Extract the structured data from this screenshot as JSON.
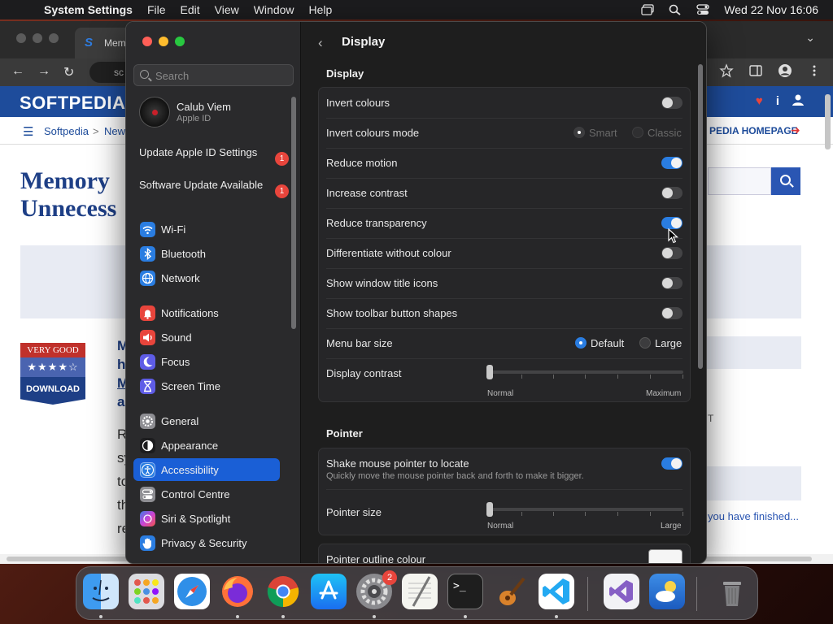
{
  "menubar": {
    "app": "System Settings",
    "items": [
      "File",
      "Edit",
      "View",
      "Window",
      "Help"
    ],
    "clock": "Wed 22 Nov  16:06"
  },
  "browser": {
    "tab_label": "Mem",
    "url_text": "sc",
    "logo": "SOFTPEDIA",
    "breadcrumb": [
      "Softpedia",
      "New"
    ],
    "breadcrumb_sep": ">",
    "homepage_link": "PEDIA HOMEPAGE",
    "headline_lines": [
      "Memory",
      "Unnecess"
    ],
    "rating": {
      "label": "VERY GOOD",
      "stars": "★★★★☆",
      "download": "DOWNLOAD"
    },
    "blurb_lines": [
      "M",
      "h",
      "M",
      "a"
    ],
    "body_lines": [
      "R",
      "sy",
      "to",
      "th",
      "re"
    ],
    "right_text_t": "T",
    "right_text": "you have finished..."
  },
  "sidebar": {
    "search_placeholder": "Search",
    "user": {
      "name": "Calub Viem",
      "subtitle": "Apple ID"
    },
    "notices": [
      {
        "label": "Update Apple ID Settings",
        "badge": "1"
      },
      {
        "label": "Software Update Available",
        "badge": "1"
      }
    ],
    "items": [
      {
        "label": "Wi-Fi",
        "icon": "wifi-icon",
        "color": "#2a7de1"
      },
      {
        "label": "Bluetooth",
        "icon": "bluetooth-icon",
        "color": "#2a7de1"
      },
      {
        "label": "Network",
        "icon": "network-icon",
        "color": "#2a7de1"
      },
      {
        "label": "Notifications",
        "icon": "notifications-icon",
        "color": "#e8453c"
      },
      {
        "label": "Sound",
        "icon": "sound-icon",
        "color": "#e8453c"
      },
      {
        "label": "Focus",
        "icon": "focus-icon",
        "color": "#5e5ce6"
      },
      {
        "label": "Screen Time",
        "icon": "screen-time-icon",
        "color": "#5e5ce6"
      },
      {
        "label": "General",
        "icon": "general-icon",
        "color": "#8e8e93"
      },
      {
        "label": "Appearance",
        "icon": "appearance-icon",
        "color": "#1c1c1e"
      },
      {
        "label": "Accessibility",
        "icon": "accessibility-icon",
        "color": "#2a7de1"
      },
      {
        "label": "Control Centre",
        "icon": "control-centre-icon",
        "color": "#8e8e93"
      },
      {
        "label": "Siri & Spotlight",
        "icon": "siri-icon",
        "color": "#b34fd6"
      },
      {
        "label": "Privacy & Security",
        "icon": "privacy-hand-icon",
        "color": "#2a7de1"
      }
    ],
    "active_item": "Accessibility"
  },
  "content": {
    "title": "Display",
    "display_section": "Display",
    "display_rows": {
      "invert_colours": {
        "label": "Invert colours",
        "on": false
      },
      "invert_mode": {
        "label": "Invert colours mode",
        "options": [
          "Smart",
          "Classic"
        ]
      },
      "reduce_motion": {
        "label": "Reduce motion",
        "on": true
      },
      "increase_contrast": {
        "label": "Increase contrast",
        "on": false
      },
      "reduce_transparency": {
        "label": "Reduce transparency",
        "on": true
      },
      "differentiate": {
        "label": "Differentiate without colour",
        "on": false
      },
      "window_title_icons": {
        "label": "Show window title icons",
        "on": false
      },
      "toolbar_shapes": {
        "label": "Show toolbar button shapes",
        "on": false
      },
      "menu_bar_size": {
        "label": "Menu bar size",
        "options": [
          "Default",
          "Large"
        ],
        "selected": "Default"
      },
      "display_contrast": {
        "label": "Display contrast",
        "min_label": "Normal",
        "max_label": "Maximum",
        "value": 0
      }
    },
    "pointer_section": "Pointer",
    "pointer_rows": {
      "shake": {
        "label": "Shake mouse pointer to locate",
        "sublabel": "Quickly move the mouse pointer back and forth to make it bigger.",
        "on": true
      },
      "pointer_size": {
        "label": "Pointer size",
        "min_label": "Normal",
        "max_label": "Large",
        "value": 0
      },
      "outline_colour": {
        "label": "Pointer outline colour",
        "swatch": "#f5f5f5"
      }
    }
  },
  "dock": {
    "apps": [
      "Finder",
      "Launchpad",
      "Safari",
      "Firefox",
      "Chrome",
      "App Store",
      "System Settings",
      "TextEdit",
      "Terminal",
      "GarageBand",
      "VS Code",
      "Visual Studio",
      "Weather",
      "Trash"
    ],
    "system_settings_badge": "2"
  }
}
